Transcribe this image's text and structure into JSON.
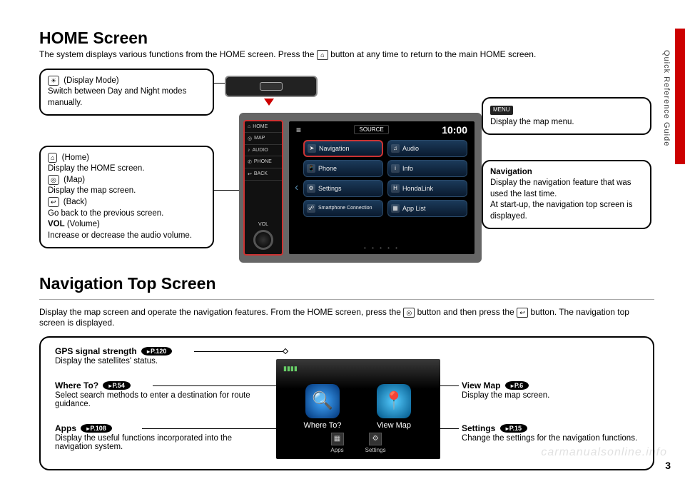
{
  "side_label": "Quick Reference Guide",
  "page_number": "3",
  "watermark": "carmanualsonline.info",
  "h1_home": "HOME Screen",
  "home_intro_a": "The system displays various functions from the HOME screen. Press the ",
  "home_intro_b": " button at any time to return to the main HOME screen.",
  "callout_display": {
    "label": "(Display Mode)",
    "text": "Switch between Day and Night modes manually."
  },
  "callout_menu": {
    "badge": "MENU",
    "text": "Display the map menu."
  },
  "callout_left": {
    "home_lbl": "(Home)",
    "home_txt": "Display the HOME screen.",
    "map_lbl": "(Map)",
    "map_txt": "Display the map screen.",
    "back_lbl": "(Back)",
    "back_txt": "Go back to the previous screen.",
    "vol_lbl": "VOL",
    "vol_paren": "(Volume)",
    "vol_txt": "Increase or decrease the audio volume."
  },
  "callout_nav": {
    "title": "Navigation",
    "l1": "Display the navigation feature that was used the last time.",
    "l2": "At start-up, the navigation top screen is displayed."
  },
  "device": {
    "left_buttons": [
      "HOME",
      "MAP",
      "AUDIO",
      "PHONE",
      "BACK"
    ],
    "vol_label": "VOL",
    "source_label": "SOURCE",
    "clock": "10:00",
    "tiles": [
      {
        "label": "Navigation",
        "icon": "➤"
      },
      {
        "label": "Audio",
        "icon": "♫"
      },
      {
        "label": "Phone",
        "icon": "📱"
      },
      {
        "label": "Info",
        "icon": "i"
      },
      {
        "label": "Settings",
        "icon": "⚙"
      },
      {
        "label": "HondaLink",
        "icon": "H"
      },
      {
        "label": "Smartphone Connection",
        "icon": "☍"
      },
      {
        "label": "App List",
        "icon": "▦"
      }
    ]
  },
  "h1_nav": "Navigation Top Screen",
  "nav_intro_a": "Display the map screen and operate the navigation features. From the HOME screen, press the ",
  "nav_intro_b": " button and then press the ",
  "nav_intro_c": " button. The navigation top screen is displayed.",
  "nav_items": {
    "gps": {
      "title": "GPS signal strength",
      "ref": "P.120",
      "desc": "Display the satellites' status."
    },
    "where": {
      "title": "Where To?",
      "ref": "P.54",
      "desc": "Select search methods to enter a destination for route guidance."
    },
    "apps": {
      "title": "Apps",
      "ref": "P.108",
      "desc": "Display the useful functions incorporated into the navigation system."
    },
    "view": {
      "title": "View Map",
      "ref": "P.6",
      "desc": "Display the map screen."
    },
    "settings": {
      "title": "Settings",
      "ref": "P.15",
      "desc": "Change the settings for the navigation functions."
    }
  },
  "nav_device": {
    "where_label": "Where To?",
    "view_label": "View Map",
    "apps_label": "Apps",
    "settings_label": "Settings"
  }
}
